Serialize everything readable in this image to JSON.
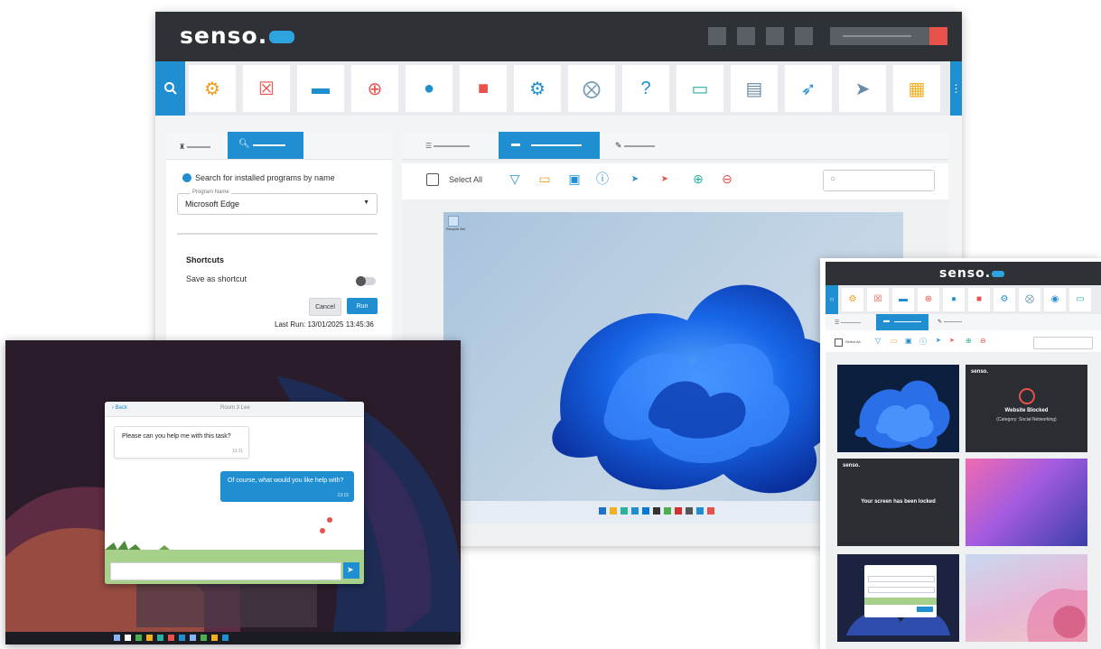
{
  "brand": {
    "name": "senso."
  },
  "colors": {
    "accent": "#1f8fd1",
    "header": "#2e3236",
    "close": "#e8524a"
  },
  "toolbar": {
    "icons": [
      "gears-icon",
      "close-box-icon",
      "monitor-icon",
      "globe-icon",
      "chat-icon",
      "lock-icon",
      "settings-icon",
      "mute-icon",
      "help-icon",
      "screen-icon",
      "document-icon",
      "rocket-icon",
      "send-icon",
      "storage-icon"
    ]
  },
  "left_panel": {
    "hint": "Search for installed programs by name",
    "program_label": "Program Name",
    "program_value": "Microsoft Edge",
    "shortcuts_title": "Shortcuts",
    "save_shortcut": "Save as shortcut",
    "cancel": "Cancel",
    "run": "Run",
    "last_run": "Last Run: 13/01/2025 13:45:36"
  },
  "view_toolbar": {
    "select_all": "Select All"
  },
  "desktop": {
    "recycle_label": "Recycle Bin"
  },
  "chat": {
    "back": "Back",
    "title": "Room 3 Lee",
    "msg1": "Please can you help me with this task?",
    "time1": "13:11",
    "msg2": "Of course, what would you like help with?",
    "time2": "13:15"
  },
  "right_window": {
    "select_all": "Select All",
    "blocked_title": "Website Blocked",
    "blocked_sub": "(Category: Social Networking)",
    "locked": "Your screen has been locked",
    "mini_logo": "senso."
  }
}
